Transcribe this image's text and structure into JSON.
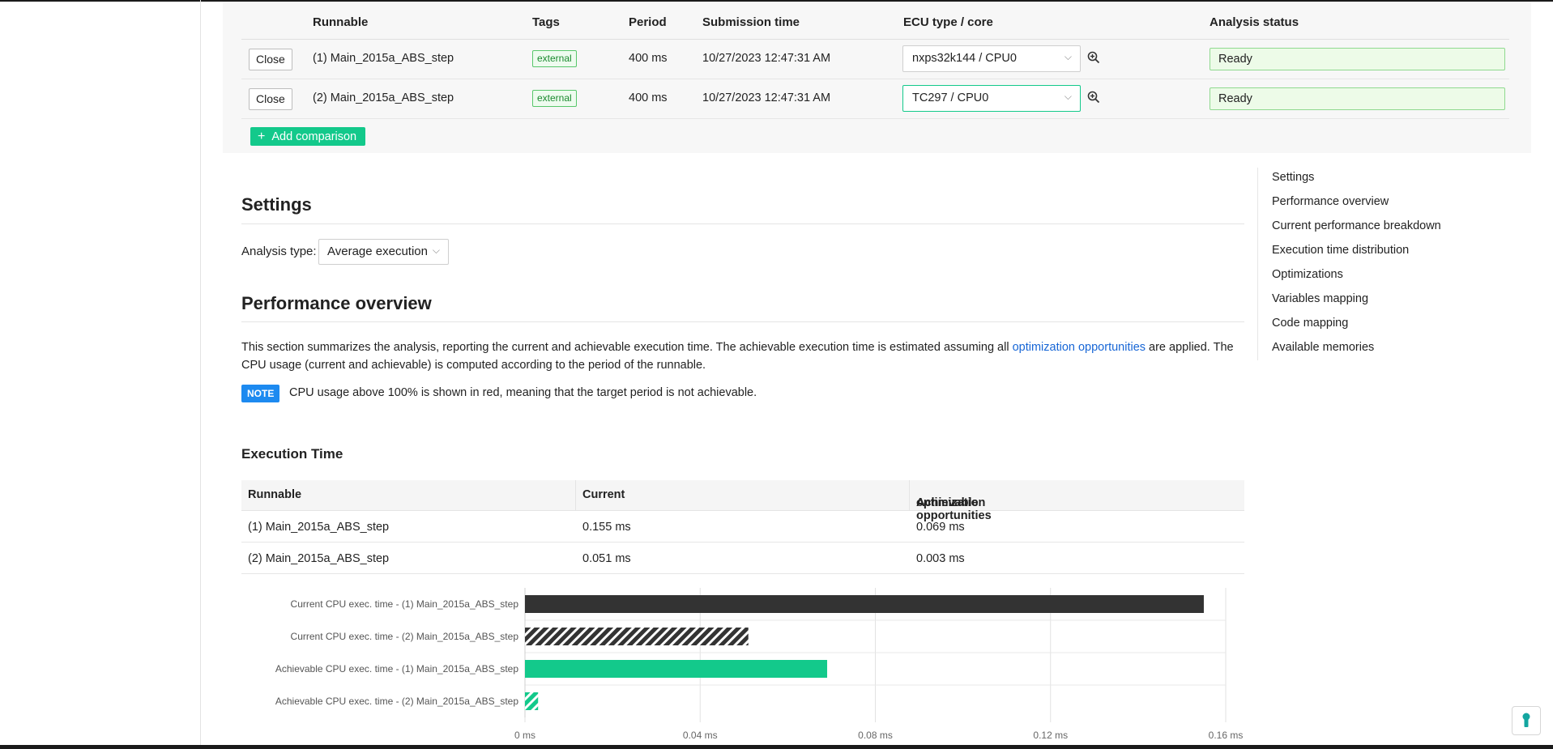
{
  "compare_table": {
    "headers": [
      "Runnable",
      "Tags",
      "Period",
      "Submission time",
      "ECU type / core",
      "Analysis status"
    ],
    "rows": [
      {
        "close": "Close",
        "runnable": "(1) Main_2015a_ABS_step",
        "tag": "external",
        "period": "400 ms",
        "submitted": "10/27/2023 12:47:31 AM",
        "ecu": "nxps32k144 / CPU0",
        "status": "Ready"
      },
      {
        "close": "Close",
        "runnable": "(2) Main_2015a_ABS_step",
        "tag": "external",
        "period": "400 ms",
        "submitted": "10/27/2023 12:47:31 AM",
        "ecu": "TC297 / CPU0",
        "status": "Ready"
      }
    ],
    "add_button": "Add comparison"
  },
  "settings": {
    "title": "Settings",
    "analysis_label": "Analysis type:",
    "analysis_value": "Average execution"
  },
  "overview": {
    "title": "Performance overview",
    "para_before": "This section summarizes the analysis, reporting the current and achievable execution time. The achievable execution time is estimated assuming all ",
    "para_link": "optimization opportunities",
    "para_after": " are applied. The CPU usage (current and achievable) is computed according to the period of the runnable.",
    "note_badge": "NOTE",
    "note_text": "CPU usage above 100% is shown in red, meaning that the target period is not achievable."
  },
  "exec_time": {
    "title": "Execution Time",
    "headers": {
      "runnable": "Runnable",
      "current": "Current",
      "achievable": "Achievable",
      "opt_link": "optimization opportunities"
    },
    "rows": [
      {
        "runnable": "(1) Main_2015a_ABS_step",
        "current": "0.155 ms",
        "achievable": "0.069 ms"
      },
      {
        "runnable": "(2) Main_2015a_ABS_step",
        "current": "0.051 ms",
        "achievable": "0.003 ms"
      }
    ]
  },
  "chart_data": {
    "type": "bar",
    "orientation": "horizontal",
    "categories": [
      "Current CPU exec. time - (1) Main_2015a_ABS_step",
      "Current CPU exec. time - (2) Main_2015a_ABS_step",
      "Achievable CPU exec. time - (1) Main_2015a_ABS_step",
      "Achievable CPU exec. time - (2) Main_2015a_ABS_step"
    ],
    "values": [
      0.155,
      0.051,
      0.069,
      0.003
    ],
    "xticks": [
      0,
      0.04,
      0.08,
      0.12,
      0.16
    ],
    "xtick_labels": [
      "0 ms",
      "0.04 ms",
      "0.08 ms",
      "0.12 ms",
      "0.16 ms"
    ],
    "xlim": [
      0,
      0.16
    ],
    "grid": true,
    "colors": [
      "#333333",
      "#333333",
      "#13c98b",
      "#13c98b"
    ],
    "hatched": [
      false,
      true,
      false,
      true
    ]
  },
  "toc": [
    "Settings",
    "Performance overview",
    "Current performance breakdown",
    "Execution time distribution",
    "Optimizations",
    "Variables mapping",
    "Code mapping",
    "Available memories"
  ],
  "icons": {
    "zoom": "zoom-in-icon",
    "chevron": "chevron-down-icon",
    "help": "help-icon"
  },
  "colors": {
    "accent": "#13c98b",
    "link": "#1766d6",
    "note": "#1d8af0",
    "ready_bg": "#edfbe8"
  }
}
